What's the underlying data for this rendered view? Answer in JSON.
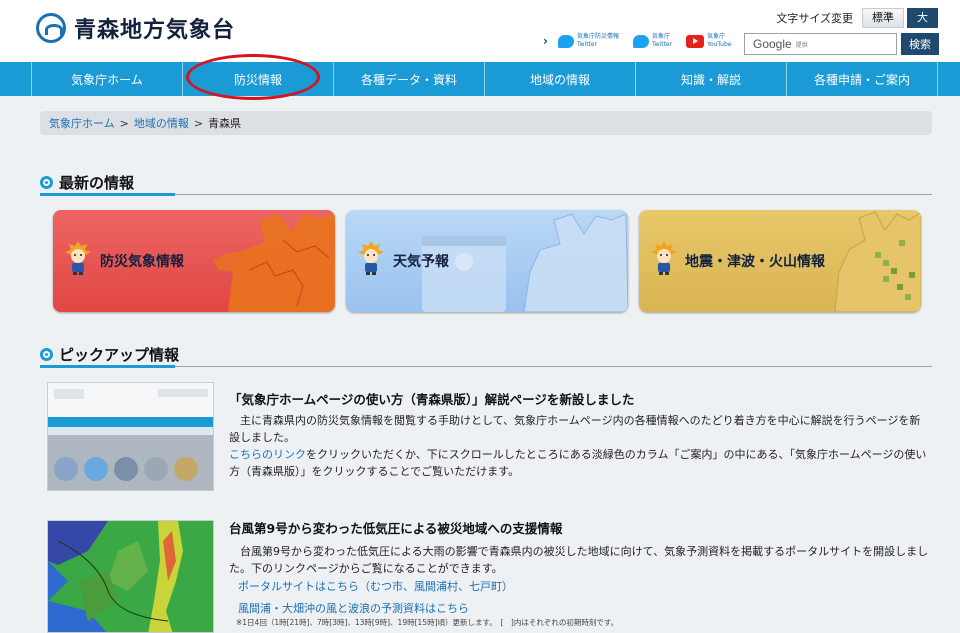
{
  "header": {
    "site_title": "青森地方気象台",
    "font_size": {
      "label": "文字サイズ変更",
      "standard": "標準",
      "large": "大"
    },
    "sns": {
      "arrow": "›",
      "links": [
        {
          "line1": "気象庁防災情報",
          "line2": "Twitter"
        },
        {
          "line1": "気象庁",
          "line2": "Twitter"
        },
        {
          "line1": "気象庁",
          "line2": "YouTube"
        }
      ]
    },
    "search": {
      "brand": "Google",
      "suffix": "提供",
      "button": "検索"
    }
  },
  "nav": {
    "items": [
      "気象庁ホーム",
      "防災情報",
      "各種データ・資料",
      "地域の情報",
      "知識・解説",
      "各種申請・ご案内"
    ],
    "highlight_color": "#d4141e"
  },
  "breadcrumb": {
    "links": [
      "気象庁ホーム",
      "地域の情報"
    ],
    "separator": ">",
    "current": "青森県"
  },
  "latest": {
    "title": "最新の情報",
    "cards": [
      {
        "label": "防災気象情報",
        "color": "#e8524f"
      },
      {
        "label": "天気予報",
        "color": "#a9cdf3"
      },
      {
        "label": "地震・津波・火山情報",
        "color": "#e2c061"
      }
    ]
  },
  "pickup": {
    "title": "ピックアップ情報",
    "items": [
      {
        "title": "「気象庁ホームページの使い方（青森県版）」解説ページを新設しました",
        "body_1": "主に青森県内の防災気象情報を閲覧する手助けとして、気象庁ホームページ内の各種情報へのたどり着き方を中心に解説を行うページを新設しました。",
        "body_link": "こちらのリンク",
        "body_2": "をクリックいただくか、下にスクロールしたところにある淡緑色のカラム「ご案内」の中にある、「気象庁ホームページの使い方（青森県版）」をクリックすることでご覧いただけます。"
      },
      {
        "title": "台風第9号から変わった低気圧による被災地域への支援情報",
        "body": "台風第9号から変わった低気圧による大雨の影響で青森県内の被災した地域に向けて、気象予測資料を掲載するポータルサイトを開設しました。下のリンクページからご覧になることができます。",
        "links": [
          "ポータルサイトはこちら（むつ市、風間浦村、七戸町）",
          "風間浦・大畑沖の風と波浪の予測資料はこちら"
        ],
        "note": "※1日4回（1時[21時]、7時[3時]、13時[9時]、19時[15時]頃）更新します。　[　]内はそれぞれの初期時刻です。"
      }
    ]
  }
}
